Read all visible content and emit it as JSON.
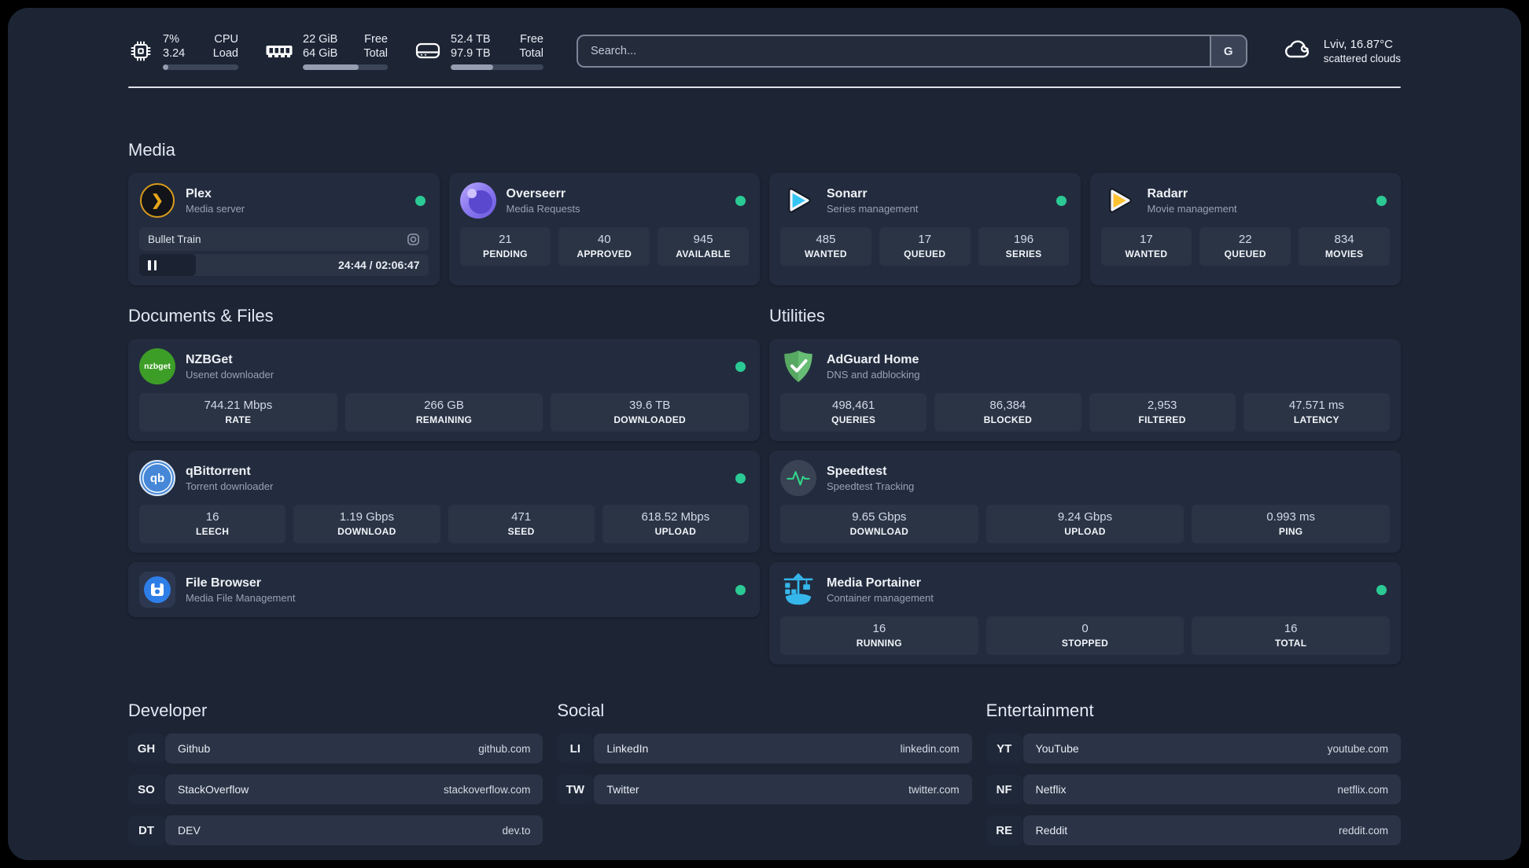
{
  "colors": {
    "page_bg": "#1d2535",
    "card_bg": "#232c3e",
    "tile_bg": "#2a3445",
    "status_online_green": "#2bc994",
    "plex_amber": "#e5a00d",
    "sonarr_blue": "#35c5f4",
    "radarr_yellow": "#ffc230",
    "portainer_blue": "#35b7ec",
    "adguard_green": "#5fb36b",
    "nzbget_green": "#3d9e27",
    "qbittorrent_blue": "#4688d7",
    "speedtest_pulse_green": "#2fd98a"
  },
  "header": {
    "system_stats": [
      {
        "icon": "cpu-icon",
        "values": [
          "7%",
          "3.24"
        ],
        "labels": [
          "CPU",
          "Load"
        ],
        "progress": 7
      },
      {
        "icon": "ram-icon",
        "values": [
          "22 GiB",
          "64 GiB"
        ],
        "labels": [
          "Free",
          "Total"
        ],
        "progress": 66
      },
      {
        "icon": "disk-icon",
        "values": [
          "52.4 TB",
          "97.9 TB"
        ],
        "labels": [
          "Free",
          "Total"
        ],
        "progress": 46
      }
    ],
    "search": {
      "placeholder": "Search...",
      "engine": "G"
    },
    "weather": {
      "icon": "cloud-icon",
      "line1": "Lviv, 16.87°C",
      "line2": "scattered clouds"
    }
  },
  "sections": {
    "media": {
      "title": "Media",
      "apps": [
        {
          "icon": "plex-icon",
          "icon_glyph": "❯",
          "name": "Plex",
          "subtitle": "Media server",
          "online": true,
          "now_playing": {
            "title": "Bullet Train",
            "time": "24:44 / 02:06:47",
            "progress": 19.5,
            "state": "paused"
          }
        },
        {
          "icon": "overseerr-icon",
          "name": "Overseerr",
          "subtitle": "Media Requests",
          "online": true,
          "stats": [
            {
              "value": "21",
              "label": "PENDING"
            },
            {
              "value": "40",
              "label": "APPROVED"
            },
            {
              "value": "945",
              "label": "AVAILABLE"
            }
          ]
        },
        {
          "icon": "sonarr-icon",
          "name": "Sonarr",
          "subtitle": "Series management",
          "online": true,
          "stats": [
            {
              "value": "485",
              "label": "WANTED"
            },
            {
              "value": "17",
              "label": "QUEUED"
            },
            {
              "value": "196",
              "label": "SERIES"
            }
          ]
        },
        {
          "icon": "radarr-icon",
          "name": "Radarr",
          "subtitle": "Movie management",
          "online": true,
          "stats": [
            {
              "value": "17",
              "label": "WANTED"
            },
            {
              "value": "22",
              "label": "QUEUED"
            },
            {
              "value": "834",
              "label": "MOVIES"
            }
          ]
        }
      ]
    },
    "documents": {
      "title": "Documents & Files",
      "apps": [
        {
          "icon": "nzbget-icon",
          "icon_text": "nzbget",
          "name": "NZBGet",
          "subtitle": "Usenet downloader",
          "online": true,
          "stats": [
            {
              "value": "744.21 Mbps",
              "label": "RATE"
            },
            {
              "value": "266 GB",
              "label": "REMAINING"
            },
            {
              "value": "39.6 TB",
              "label": "DOWNLOADED"
            }
          ]
        },
        {
          "icon": "qbittorrent-icon",
          "icon_text": "qb",
          "name": "qBittorrent",
          "subtitle": "Torrent downloader",
          "online": true,
          "stats": [
            {
              "value": "16",
              "label": "LEECH"
            },
            {
              "value": "1.19 Gbps",
              "label": "DOWNLOAD"
            },
            {
              "value": "471",
              "label": "SEED"
            },
            {
              "value": "618.52 Mbps",
              "label": "UPLOAD"
            }
          ]
        },
        {
          "icon": "filebrowser-icon",
          "name": "File Browser",
          "subtitle": "Media File Management",
          "online": true
        }
      ]
    },
    "utilities": {
      "title": "Utilities",
      "apps": [
        {
          "icon": "adguard-icon",
          "name": "AdGuard Home",
          "subtitle": "DNS and adblocking",
          "online": false,
          "stats": [
            {
              "value": "498,461",
              "label": "QUERIES"
            },
            {
              "value": "86,384",
              "label": "BLOCKED"
            },
            {
              "value": "2,953",
              "label": "FILTERED"
            },
            {
              "value": "47.571 ms",
              "label": "LATENCY"
            }
          ]
        },
        {
          "icon": "speedtest-icon",
          "name": "Speedtest",
          "subtitle": "Speedtest Tracking",
          "online": false,
          "stats": [
            {
              "value": "9.65 Gbps",
              "label": "DOWNLOAD"
            },
            {
              "value": "9.24 Gbps",
              "label": "UPLOAD"
            },
            {
              "value": "0.993 ms",
              "label": "PING"
            }
          ]
        },
        {
          "icon": "portainer-icon",
          "name": "Media Portainer",
          "subtitle": "Container management",
          "online": true,
          "stats": [
            {
              "value": "16",
              "label": "RUNNING"
            },
            {
              "value": "0",
              "label": "STOPPED"
            },
            {
              "value": "16",
              "label": "TOTAL"
            }
          ]
        }
      ]
    },
    "bookmarks": [
      {
        "title": "Developer",
        "links": [
          {
            "abbr": "GH",
            "name": "Github",
            "url": "github.com"
          },
          {
            "abbr": "SO",
            "name": "StackOverflow",
            "url": "stackoverflow.com"
          },
          {
            "abbr": "DT",
            "name": "DEV",
            "url": "dev.to"
          }
        ]
      },
      {
        "title": "Social",
        "links": [
          {
            "abbr": "LI",
            "name": "LinkedIn",
            "url": "linkedin.com"
          },
          {
            "abbr": "TW",
            "name": "Twitter",
            "url": "twitter.com"
          }
        ]
      },
      {
        "title": "Entertainment",
        "links": [
          {
            "abbr": "YT",
            "name": "YouTube",
            "url": "youtube.com"
          },
          {
            "abbr": "NF",
            "name": "Netflix",
            "url": "netflix.com"
          },
          {
            "abbr": "RE",
            "name": "Reddit",
            "url": "reddit.com"
          }
        ]
      }
    ]
  }
}
